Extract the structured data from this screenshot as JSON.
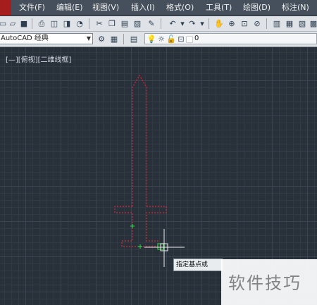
{
  "menu": [
    "文件(F)",
    "编辑(E)",
    "视图(V)",
    "插入(I)",
    "格式(O)",
    "工具(T)",
    "绘图(D)",
    "标注(N)"
  ],
  "workspace": {
    "selected": "AutoCAD 经典"
  },
  "layer": {
    "current": "0"
  },
  "viewport": {
    "label": "[—][俯视][二维线框]"
  },
  "command_prompt": "指定基点或",
  "watermark": "软件技巧",
  "colors": {
    "menubar": "#46505c",
    "toolbar": "#dfe3e8",
    "canvas": "#283039",
    "drawing_line": "#d02a3c",
    "grip": "#2ecc40",
    "crosshair": "#f0f0f0"
  },
  "icons": {
    "toolbar1": [
      "new-icon",
      "open-icon",
      "save-icon",
      "plot-icon",
      "plot-preview-icon",
      "publish-icon",
      "3d-print-icon",
      "cut-icon",
      "copy-icon",
      "paste-icon",
      "match-properties-icon",
      "undo-icon",
      "redo-icon",
      "pan-icon",
      "zoom-realtime-icon",
      "zoom-window-icon",
      "zoom-previous-icon",
      "properties-icon",
      "design-center-icon",
      "tool-palettes-icon"
    ],
    "toolbar2": [
      "workspace-settings-icon",
      "layer-manager-icon",
      "layer-on-icon",
      "layer-freeze-icon",
      "layer-lock-icon",
      "layer-color-icon"
    ]
  }
}
